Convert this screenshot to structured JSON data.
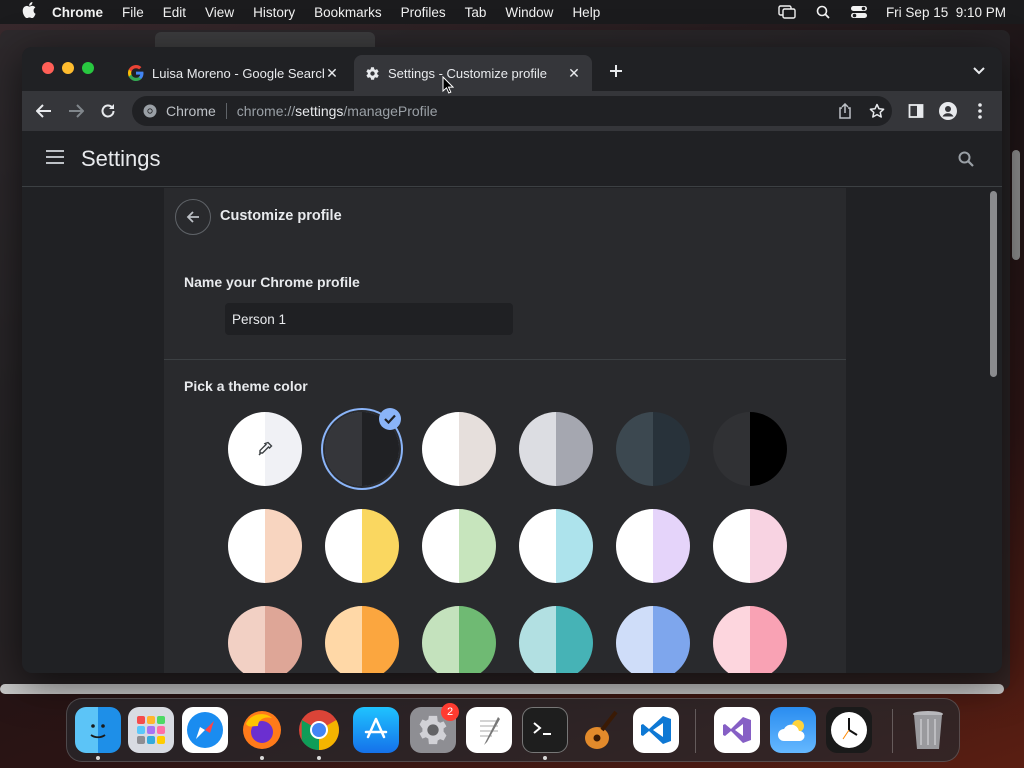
{
  "menubar": {
    "app_name": "Chrome",
    "items": [
      "File",
      "Edit",
      "View",
      "History",
      "Bookmarks",
      "Profiles",
      "Tab",
      "Window",
      "Help"
    ],
    "clock": "Fri Sep 15  9:10 PM"
  },
  "tabs": [
    {
      "title": "Luisa Moreno - Google Search",
      "favicon": "google-icon"
    },
    {
      "title": "Settings - Customize profile",
      "favicon": "gear-icon"
    }
  ],
  "omnibox": {
    "chip": "Chrome",
    "url_scheme": "chrome://",
    "url_host": "settings",
    "url_path": "/manageProfile"
  },
  "settings": {
    "title": "Settings",
    "page_title": "Customize profile",
    "name_label": "Name your Chrome profile",
    "name_value": "Person 1",
    "theme_label": "Pick a theme color"
  },
  "theme_colors": [
    {
      "left": "#ffffff",
      "right": "#f0f1f5",
      "type": "custom-picker"
    },
    {
      "left": "#35363a",
      "right": "#202124",
      "selected": true
    },
    {
      "left": "#ffffff",
      "right": "#e6dfdc"
    },
    {
      "left": "#dcdde2",
      "right": "#a5a7b0"
    },
    {
      "left": "#3c4850",
      "right": "#28323a"
    },
    {
      "left": "#303134",
      "right": "#000000"
    },
    {
      "left": "#ffffff",
      "right": "#f8d5c0"
    },
    {
      "left": "#ffffff",
      "right": "#fad760"
    },
    {
      "left": "#ffffff",
      "right": "#c7e5bd"
    },
    {
      "left": "#ffffff",
      "right": "#ade3ec"
    },
    {
      "left": "#ffffff",
      "right": "#e5d4fa"
    },
    {
      "left": "#ffffff",
      "right": "#f8d3e2"
    },
    {
      "left": "#f2d0c4",
      "right": "#dea697"
    },
    {
      "left": "#ffd8a7",
      "right": "#fba63f"
    },
    {
      "left": "#c4e2bd",
      "right": "#6fba73"
    },
    {
      "left": "#b2e0e2",
      "right": "#46b3b6"
    },
    {
      "left": "#cfddf9",
      "right": "#7ea6ed"
    },
    {
      "left": "#fdd6de",
      "right": "#f9a2b4"
    }
  ],
  "dock": {
    "apps": [
      "finder-icon",
      "launchpad-icon",
      "safari-icon",
      "firefox-icon",
      "chrome-icon",
      "app-store-icon",
      "system-settings-icon",
      "textedit-icon",
      "terminal-icon",
      "garageband-icon",
      "vscode-icon",
      "visual-studio-icon",
      "weather-icon",
      "clock-icon",
      "trash-icon"
    ],
    "settings_badge": "2"
  }
}
